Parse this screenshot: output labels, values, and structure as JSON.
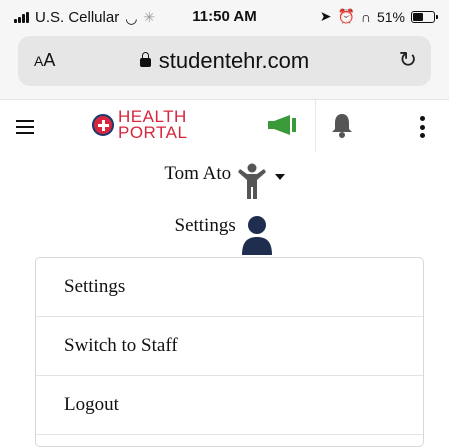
{
  "status_bar": {
    "carrier": "U.S. Cellular",
    "time": "11:50 AM",
    "battery": "51%",
    "battery_level": 0.51,
    "icons": [
      "signal-icon",
      "wifi-icon",
      "loading-icon",
      "location-arrow-icon",
      "alarm-icon",
      "headphones-icon",
      "battery-icon"
    ]
  },
  "browser": {
    "text_size_label": "AA",
    "url": "studentehr.com",
    "icons": [
      "lock-icon",
      "reload-icon"
    ]
  },
  "app_nav": {
    "logo_line1": "HEALTH",
    "logo_line2": "PORTAL",
    "icons": [
      "hamburger-menu-icon",
      "megaphone-icon",
      "bell-icon",
      "kebab-menu-icon"
    ],
    "colors": {
      "logo_red": "#d7263d",
      "megaphone_green": "#3a9a3a",
      "bell_gray": "#555555"
    }
  },
  "user": {
    "name": "Tom Ato",
    "icon_color": "#555555"
  },
  "settings_header": {
    "label": "Settings",
    "icon_color": "#1f2d4f"
  },
  "menu": {
    "items": [
      "Settings",
      "Switch to Staff",
      "Logout"
    ]
  }
}
